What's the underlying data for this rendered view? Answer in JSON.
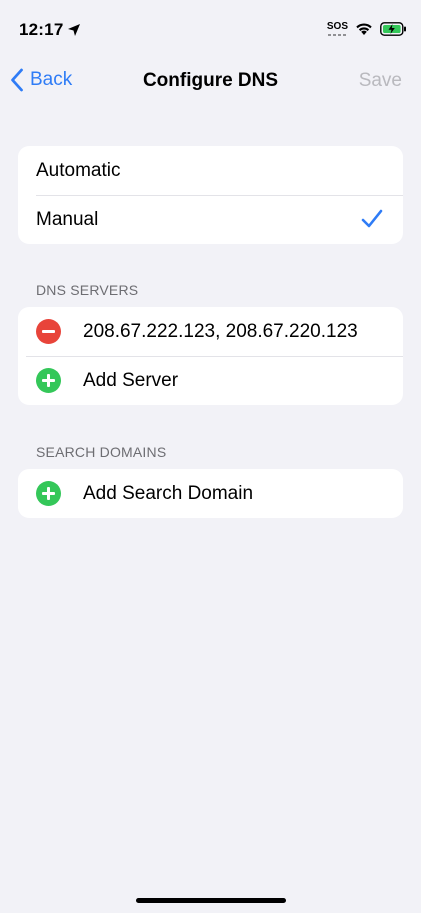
{
  "status_bar": {
    "time": "12:17",
    "sos": "SOS",
    "icons": [
      "location-arrow-icon",
      "wifi-icon",
      "battery-charging-icon"
    ]
  },
  "nav": {
    "back_label": "Back",
    "title": "Configure DNS",
    "save_label": "Save"
  },
  "mode_group": {
    "items": [
      {
        "label": "Automatic",
        "selected": false
      },
      {
        "label": "Manual",
        "selected": true
      }
    ]
  },
  "dns_servers": {
    "header": "DNS SERVERS",
    "server_value": "208.67.222.123, 208.67.220.123",
    "add_label": "Add Server"
  },
  "search_domains": {
    "header": "SEARCH DOMAINS",
    "add_label": "Add Search Domain"
  },
  "colors": {
    "accent": "#2f7cf6",
    "background": "#f2f2f7",
    "delete": "#e8443a",
    "add": "#34c759",
    "disabled": "#b9b9be"
  }
}
